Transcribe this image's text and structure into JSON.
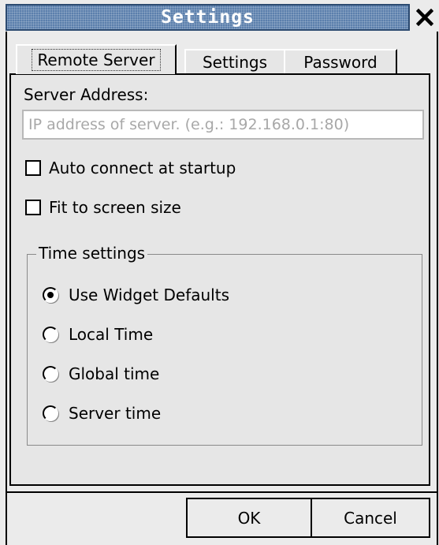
{
  "window": {
    "title": "Settings",
    "close_icon": "close-icon"
  },
  "tabs": [
    {
      "label": "Remote Server",
      "active": true
    },
    {
      "label": "Settings",
      "active": false
    },
    {
      "label": "Password",
      "active": false
    }
  ],
  "server": {
    "label": "Server Address:",
    "value": "",
    "placeholder": "IP address of server. (e.g.: 192.168.0.1:80)"
  },
  "checkboxes": {
    "auto_connect": {
      "label": "Auto connect at startup",
      "checked": false
    },
    "fit_screen": {
      "label": "Fit to screen size",
      "checked": false
    }
  },
  "time_settings": {
    "title": "Time settings",
    "options": [
      {
        "label": "Use Widget Defaults",
        "selected": true
      },
      {
        "label": "Local Time",
        "selected": false
      },
      {
        "label": "Global time",
        "selected": false
      },
      {
        "label": "Server time",
        "selected": false
      }
    ]
  },
  "buttons": {
    "ok": "OK",
    "cancel": "Cancel"
  },
  "colors": {
    "titlebar": "#5b7fac",
    "background": "#ebebeb"
  }
}
